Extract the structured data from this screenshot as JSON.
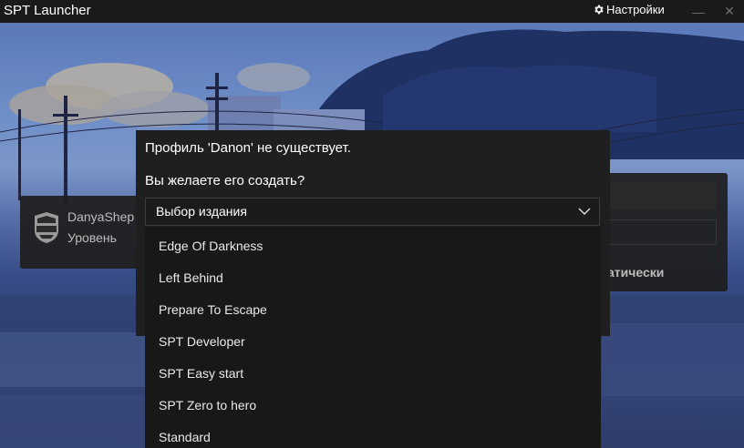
{
  "window": {
    "title": "SPT Launcher",
    "settings_label": "Настройки",
    "minimize_symbol": "—",
    "close_symbol": "✕"
  },
  "profile": {
    "username": "DanyaShep",
    "level_label": "Уровень"
  },
  "right_panel": {
    "auto_label": "атически"
  },
  "dialog": {
    "message": "Профиль 'Danon' не существует.",
    "question": "Вы желаете его создать?",
    "select_placeholder": "Выбор издания"
  },
  "editions": [
    "Edge Of Darkness",
    "Left Behind",
    "Prepare To Escape",
    "SPT Developer",
    "SPT Easy start",
    "SPT Zero to hero",
    "Standard"
  ],
  "icons": {
    "settings": "gear-icon",
    "chevron": "chevron-down-icon",
    "faction": "usec-logo"
  }
}
